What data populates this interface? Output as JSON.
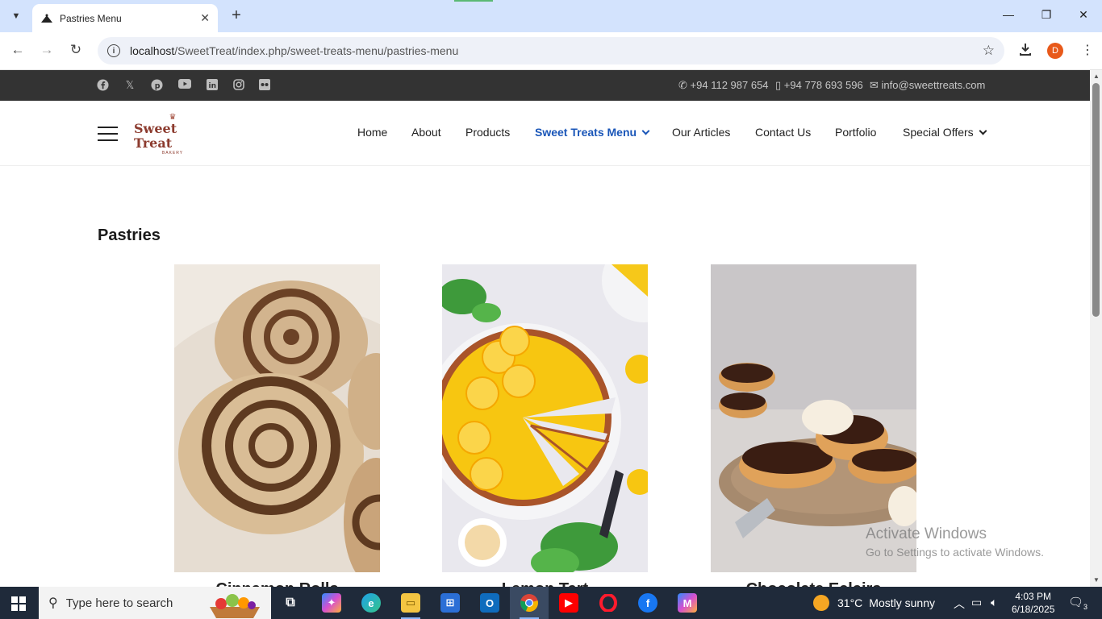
{
  "browser": {
    "tab_title": "Pastries Menu",
    "url_host": "localhost",
    "url_path": "/SweetTreat/index.php/sweet-treats-menu/pastries-menu",
    "profile_initial": "D"
  },
  "topbar": {
    "phone": "+94 112 987 654",
    "mobile": "+94 778 693 596",
    "email": "info@sweettreats.com",
    "social_icons": [
      "facebook-icon",
      "x-icon",
      "pinterest-icon",
      "youtube-icon",
      "linkedin-icon",
      "instagram-icon",
      "flickr-icon"
    ]
  },
  "logo": {
    "name": "Sweet Treat",
    "sub": "BAKERY"
  },
  "nav": {
    "items": [
      {
        "label": "Home"
      },
      {
        "label": "About"
      },
      {
        "label": "Products"
      },
      {
        "label": "Sweet Treats Menu"
      },
      {
        "label": "Our Articles"
      },
      {
        "label": "Contact Us"
      },
      {
        "label": "Portfolio"
      },
      {
        "label": "Special Offers"
      }
    ],
    "active_color": "#1a56b8"
  },
  "page": {
    "title": "Pastries",
    "cards": [
      {
        "label": "Cinnamon Rolls"
      },
      {
        "label": "Lemon Tart"
      },
      {
        "label": "Chocolate Eclairs"
      }
    ]
  },
  "watermark": {
    "line1": "Activate Windows",
    "line2": "Go to Settings to activate Windows."
  },
  "taskbar": {
    "search_placeholder": "Type here to search",
    "weather_temp": "31°C",
    "weather_text": "Mostly sunny",
    "time": "4:03 PM",
    "date": "6/18/2025",
    "notification_count": "3"
  },
  "colors": {
    "topbar": "#333333",
    "tabstrip": "#d3e3fd",
    "taskbar": "#1f2a3a"
  }
}
